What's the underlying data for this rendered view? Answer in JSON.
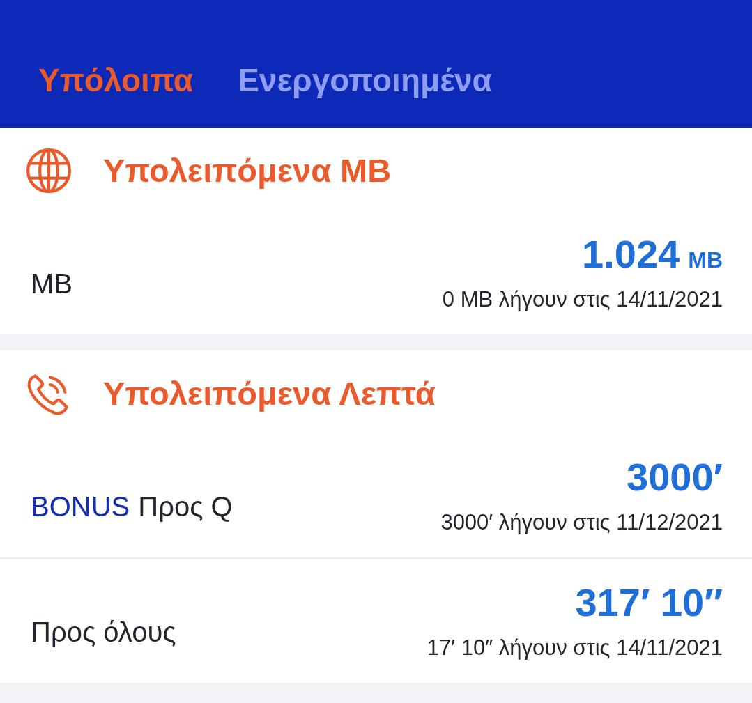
{
  "tabs": [
    {
      "label": "Υπόλοιπα",
      "selected": true
    },
    {
      "label": "Ενεργοποιημένα",
      "selected": false
    }
  ],
  "sections": [
    {
      "kind": "data",
      "title": "Υπολειπόμενα MB",
      "items": [
        {
          "label": "MB",
          "value": "1.024",
          "unit": "MB",
          "expiry": "0 MB λήγουν στις 14/11/2021"
        }
      ]
    },
    {
      "kind": "calls",
      "title": "Υπολειπόμενα Λεπτά",
      "items": [
        {
          "badge": "BONUS",
          "label": "Προς Q",
          "value": "3000′",
          "expiry": "3000′ λήγουν στις 11/12/2021"
        },
        {
          "label": "Προς όλους",
          "value": "317′ 10″",
          "expiry": "17′ 10″ λήγουν στις 14/11/2021"
        }
      ]
    }
  ]
}
